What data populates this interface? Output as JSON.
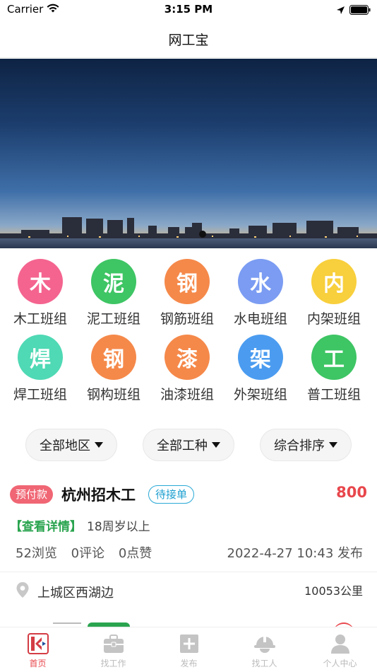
{
  "status_bar": {
    "carrier": "Carrier",
    "time": "3:15 PM"
  },
  "nav": {
    "title": "网工宝"
  },
  "categories": [
    {
      "icon_char": "木",
      "label": "木工班组",
      "color": "#f4648f"
    },
    {
      "icon_char": "泥",
      "label": "泥工班组",
      "color": "#3ec564"
    },
    {
      "icon_char": "钢",
      "label": "钢筋班组",
      "color": "#f5894a"
    },
    {
      "icon_char": "水",
      "label": "水电班组",
      "color": "#7b9cf2"
    },
    {
      "icon_char": "内",
      "label": "内架班组",
      "color": "#f8cf3c"
    },
    {
      "icon_char": "焊",
      "label": "焊工班组",
      "color": "#4fd9b4"
    },
    {
      "icon_char": "钢",
      "label": "钢构班组",
      "color": "#f5894a"
    },
    {
      "icon_char": "漆",
      "label": "油漆班组",
      "color": "#f5894a"
    },
    {
      "icon_char": "架",
      "label": "外架班组",
      "color": "#4b9cf0"
    },
    {
      "icon_char": "工",
      "label": "普工班组",
      "color": "#3ec564"
    }
  ],
  "filters": [
    {
      "label": "全部地区"
    },
    {
      "label": "全部工种"
    },
    {
      "label": "综合排序"
    }
  ],
  "job": {
    "tag": "预付款",
    "title": "杭州招木工",
    "status": "待接单",
    "price": "800",
    "detail_link": "【查看详情】",
    "requirement": "18周岁以上",
    "views": "52浏览",
    "comments": "0评论",
    "likes": "0点赞",
    "published": "2022-4-27 10:43 发布",
    "address": "上城区西湖边",
    "distance": "10053公里"
  },
  "tabs": [
    {
      "label": "首页",
      "icon": "home-logo-icon",
      "active": true
    },
    {
      "label": "找工作",
      "icon": "briefcase-icon",
      "active": false
    },
    {
      "label": "发布",
      "icon": "plus-square-icon",
      "active": false
    },
    {
      "label": "找工人",
      "icon": "hard-hat-icon",
      "active": false
    },
    {
      "label": "个人中心",
      "icon": "person-icon",
      "active": false
    }
  ],
  "colors": {
    "accent": "#e8474c",
    "link_green": "#2aa44f",
    "status_blue": "#29a9d6",
    "prepay_pink": "#f06674"
  }
}
